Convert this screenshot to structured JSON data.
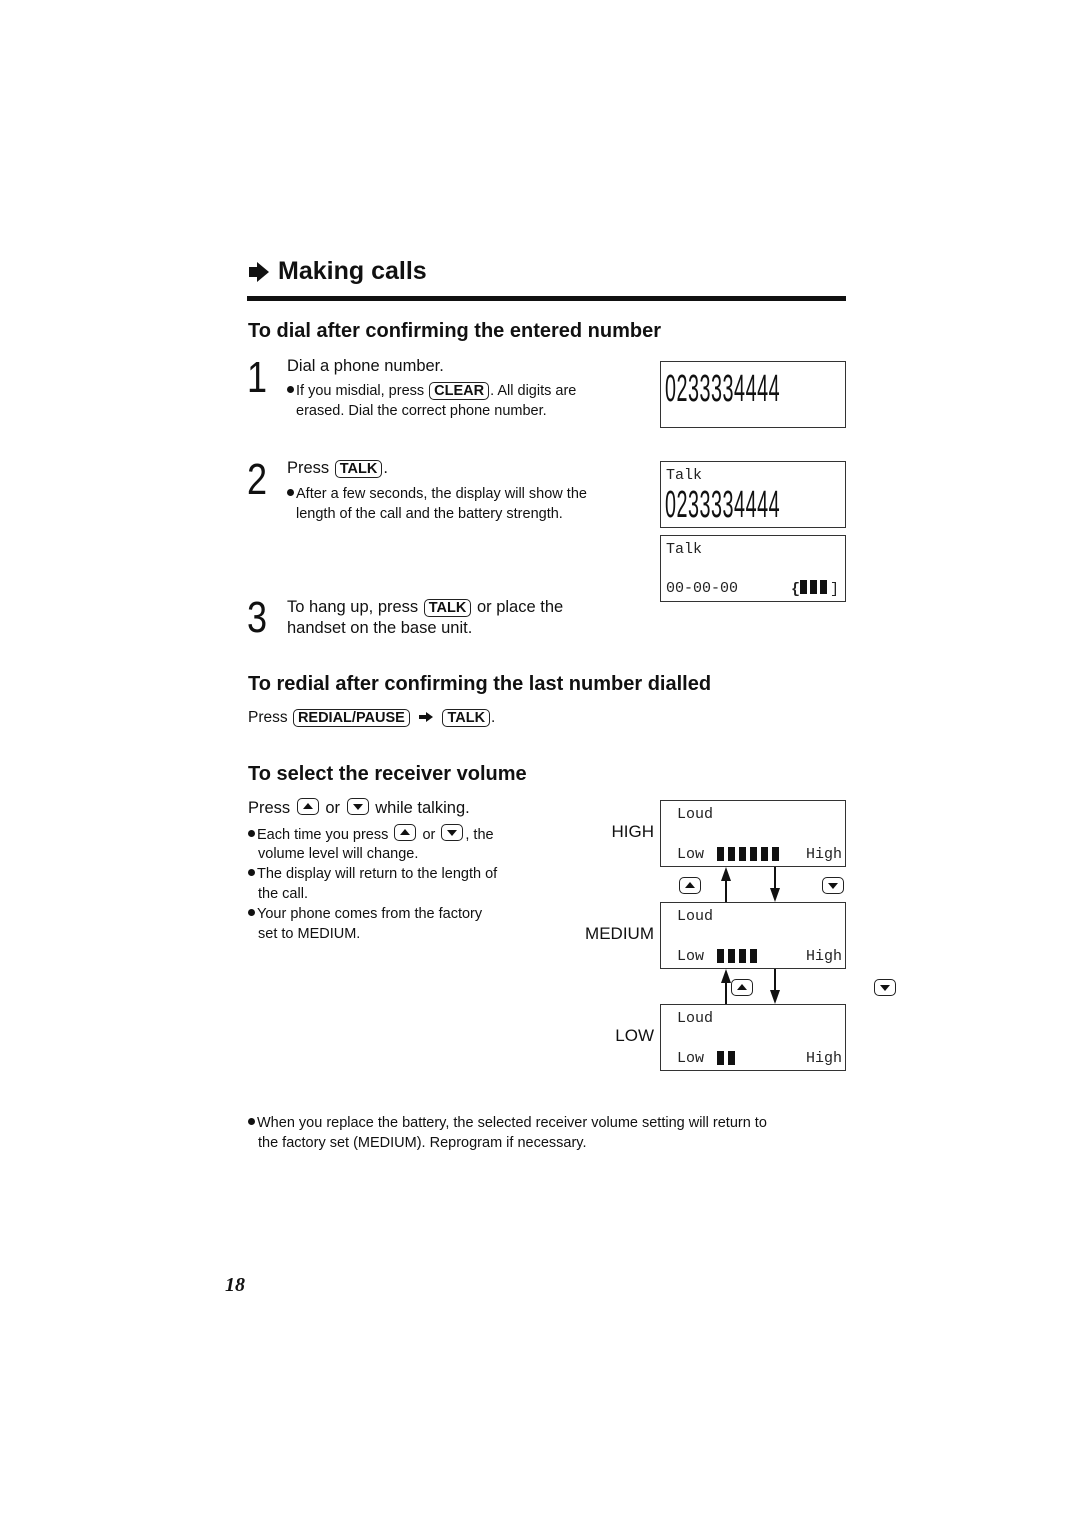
{
  "section": {
    "title": "Making calls"
  },
  "dial_section": {
    "heading": "To dial after confirming the entered number",
    "steps": [
      {
        "number": "1",
        "text": "Dial a phone number.",
        "bullet_pre": "If you misdial, press",
        "bullet_key": "CLEAR",
        "bullet_post": ". All digits are",
        "bullet_line2": "erased. Dial the correct phone number."
      },
      {
        "number": "2",
        "text_pre": "Press",
        "text_key": "TALK",
        "text_post": ".",
        "bullet_line1": "After a few seconds, the display will show the",
        "bullet_line2": "length of the call and the battery strength."
      },
      {
        "number": "3",
        "text_pre": "To hang up, press",
        "text_key": "TALK",
        "text_post": "or place the",
        "text_line2": "handset on the base unit."
      }
    ],
    "displays": [
      {
        "line1": "",
        "digits": "0233334444"
      },
      {
        "line1": "Talk",
        "digits": "0233334444"
      },
      {
        "line1": "Talk",
        "timer": "00-00-00",
        "battery_open": "{",
        "battery_close": "]",
        "battery_bars": 3
      }
    ]
  },
  "redial_section": {
    "heading": "To redial after confirming the last number dialled",
    "press_label": "Press",
    "key1": "REDIAL/PAUSE",
    "key2": "TALK",
    "end": "."
  },
  "volume_section": {
    "heading": "To select the receiver volume",
    "press_pre": "Press",
    "press_or": "or",
    "press_post": "while talking.",
    "bullets": [
      {
        "pre": "Each time you press",
        "or": "or",
        "post": ", the",
        "line2": "volume level will change."
      },
      {
        "line1": "The display will return to the length of",
        "line2": "the call."
      },
      {
        "line1": "Your phone comes from the factory",
        "line2": "set to MEDIUM."
      }
    ],
    "levels": [
      {
        "label": "HIGH",
        "top": "Loud",
        "low": "Low",
        "high": "High",
        "bars": 6,
        "max_bars": 6
      },
      {
        "label": "MEDIUM",
        "top": "Loud",
        "low": "Low",
        "high": "High",
        "bars": 4,
        "max_bars": 6
      },
      {
        "label": "LOW",
        "top": "Loud",
        "low": "Low",
        "high": "High",
        "bars": 2,
        "max_bars": 6
      }
    ]
  },
  "footer_note": {
    "line1": "When you replace the battery, the selected receiver volume setting will return to",
    "line2": "the factory set (MEDIUM). Reprogram if necessary."
  },
  "page_number": "18"
}
